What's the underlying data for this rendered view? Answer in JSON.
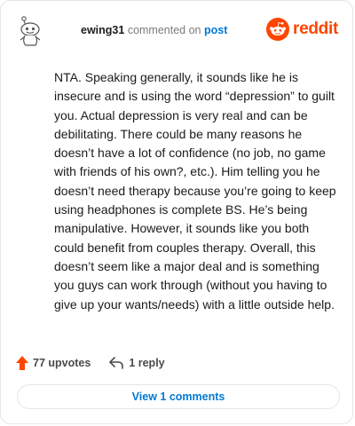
{
  "header": {
    "username": "ewing31",
    "action": "commented on",
    "post_link": "post",
    "brand": "reddit",
    "brand_color": "#ff4500"
  },
  "comment": {
    "text": "NTA. Speaking generally, it sounds like he is insecure and is using the word “depression” to guilt you. Actual depression is very real and can be debilitating. There could be many reasons he doesn’t have a lot of confidence (no job, no game with friends of his own?, etc.). Him telling you he doesn’t need therapy because you’re going to keep using headphones is complete BS. He’s being manipulative. However, it sounds like you both could benefit from couples therapy. Overall, this doesn’t seem like a major deal and is something you guys can work through (without you having to give up your wants/needs) with a little outside help."
  },
  "footer": {
    "upvotes_label": "77 upvotes",
    "reply_label": "1 reply",
    "upvote_icon": "upvote-arrow-icon",
    "reply_icon": "reply-arrow-icon",
    "upvote_color": "#ff4500"
  },
  "view_comments_label": "View 1 comments",
  "link_color": "#0079d3"
}
